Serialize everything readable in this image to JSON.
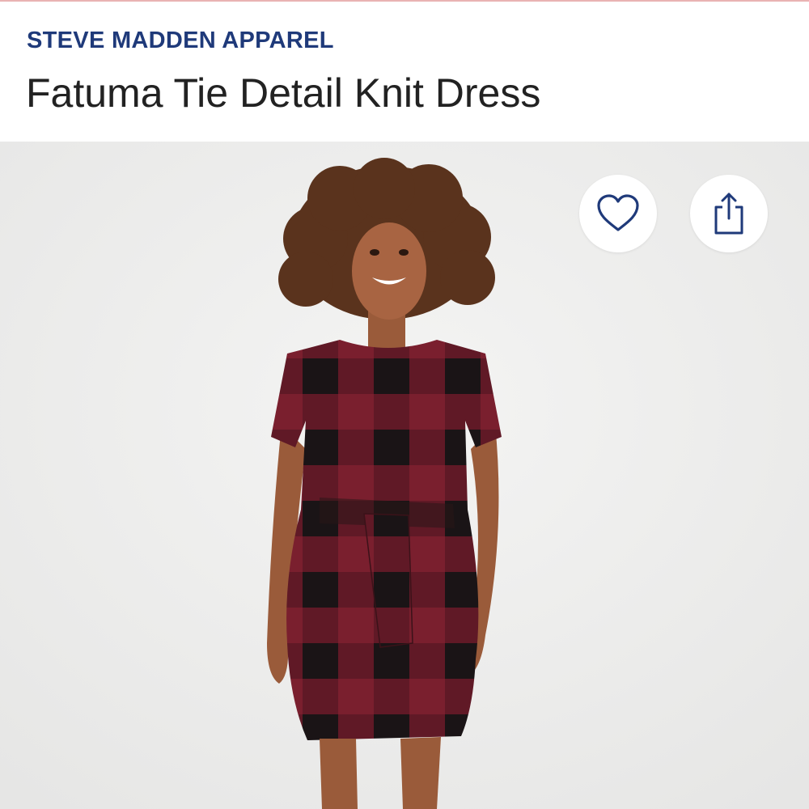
{
  "product": {
    "brand": "STEVE MADDEN APPAREL",
    "title": "Fatuma Tie Detail Knit Dress"
  },
  "actions": {
    "favorite_icon": "heart-icon",
    "share_icon": "share-icon"
  },
  "colors": {
    "brand": "#1f3a7a",
    "title": "#222222",
    "dress_red": "#7a1f2e",
    "dress_black": "#1a1416",
    "background": "#efefee"
  }
}
